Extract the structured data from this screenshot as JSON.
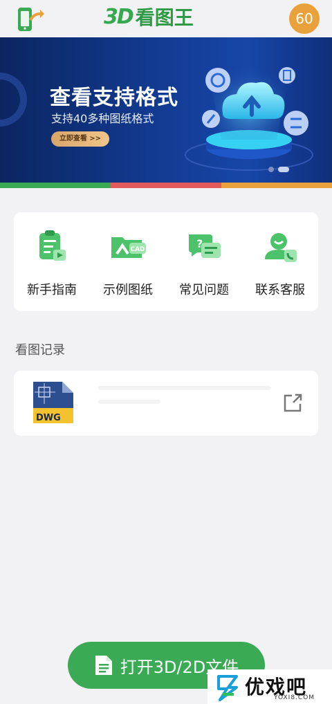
{
  "header": {
    "logo_3d": "3D",
    "logo_text": "看图王",
    "points": "60",
    "left_icon": "phone-share-icon"
  },
  "banner": {
    "title": "查看支持格式",
    "subtitle": "支持40多种图纸格式",
    "button_label": "立即查看 >>",
    "carousel_index": 1,
    "carousel_count": 3
  },
  "color_bar": [
    "#3aaa55",
    "#e05a5a",
    "#e9a23b"
  ],
  "quick_actions": [
    {
      "label": "新手指南",
      "icon": "guide-clipboard-icon"
    },
    {
      "label": "示例图纸",
      "icon": "cad-folder-icon"
    },
    {
      "label": "常见问题",
      "icon": "faq-chat-icon"
    },
    {
      "label": "联系客服",
      "icon": "customer-service-icon"
    }
  ],
  "history": {
    "title": "看图记录",
    "items": [
      {
        "file_type": "DWG",
        "icon": "dwg-file-icon",
        "action_icon": "open-external-icon"
      }
    ]
  },
  "open_button": {
    "label": "打开3D/2D文件",
    "icon": "document-icon"
  },
  "watermark": {
    "text": "优戏吧",
    "sub": "YOXI8.COM"
  },
  "colors": {
    "accent_green": "#3aaa55",
    "badge_orange": "#e9a23b",
    "background": "#f2f2f4"
  }
}
